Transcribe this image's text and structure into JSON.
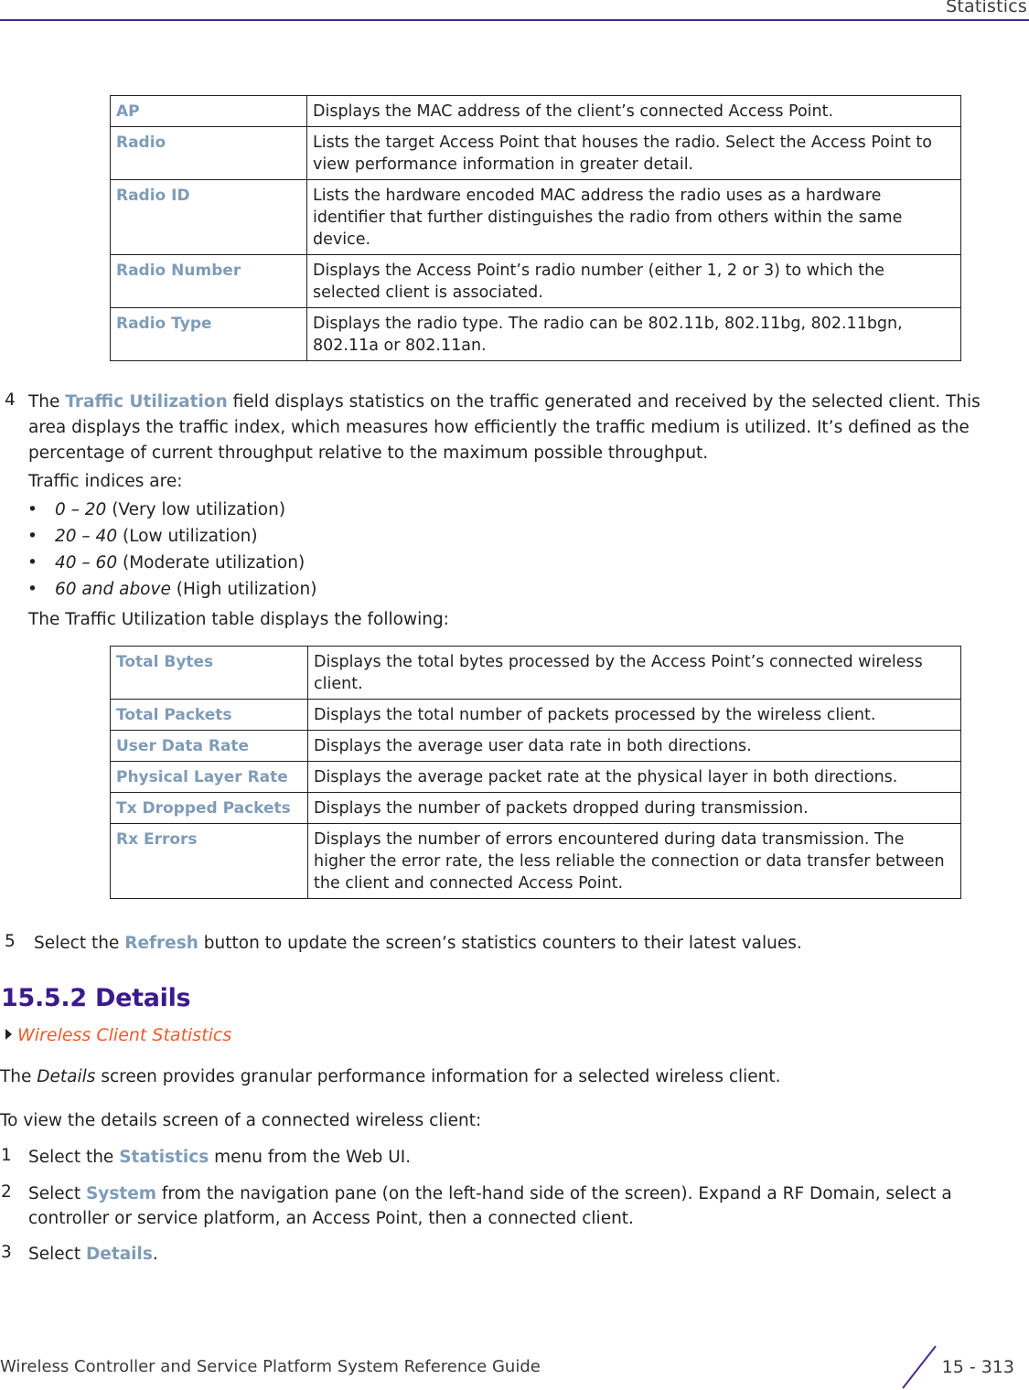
{
  "header": {
    "title": "Statistics"
  },
  "table1": {
    "rows": [
      {
        "term": "AP",
        "desc": "Displays the MAC address of the client’s connected Access Point."
      },
      {
        "term": "Radio",
        "desc": "Lists the target Access Point that houses the radio. Select the Access Point to view performance information in greater detail."
      },
      {
        "term": "Radio ID",
        "desc": "Lists the hardware encoded MAC address the radio uses as a hardware identifier that further distinguishes the radio from others within the same device."
      },
      {
        "term": "Radio Number",
        "desc": "Displays the Access Point’s radio number (either 1, 2 or 3) to which the selected client is associated."
      },
      {
        "term": "Radio Type",
        "desc": "Displays the radio type. The radio can be 802.11b, 802.11bg, 802.11bgn, 802.11a or 802.11an."
      }
    ]
  },
  "step4": {
    "number": "4",
    "prefix": "The ",
    "bold": "Traffic Utilization",
    "line1_rest": " field displays statistics on the traffic generated and received by the selected client. This",
    "line2": "area displays the traffic index, which measures how efficiently the traffic medium is utilized. It’s defined as the",
    "line3": "percentage of current throughput relative to the maximum possible throughput.",
    "indices_intro": "Traffic indices are:",
    "bullets": [
      {
        "range": "0 – 20",
        "label": " (Very low utilization)"
      },
      {
        "range": "20 – 40",
        "label": " (Low utilization)"
      },
      {
        "range": "40 – 60",
        "label": " (Moderate utilization)"
      },
      {
        "range": "60 and above",
        "label": " (High utilization)"
      }
    ],
    "table_intro": "The Traffic Utilization table displays the following:"
  },
  "table2": {
    "rows": [
      {
        "term": "Total Bytes",
        "desc": "Displays the total bytes processed by the Access Point’s connected wireless client."
      },
      {
        "term": "Total Packets",
        "desc": "Displays the total number of packets processed by the wireless client."
      },
      {
        "term": "User Data Rate",
        "desc": "Displays the average user data rate in both directions."
      },
      {
        "term": "Physical Layer Rate",
        "desc": "Displays the average packet rate at the physical layer in both directions."
      },
      {
        "term": "Tx Dropped Packets",
        "desc": "Displays the number of packets dropped during transmission."
      },
      {
        "term": "Rx Errors",
        "desc": "Displays the number of errors encountered during data transmission. The higher the error rate, the less reliable the connection or data transfer between the client and connected Access Point."
      }
    ]
  },
  "step5": {
    "number": "5",
    "prefix": "Select the ",
    "bold": "Refresh",
    "rest": " button to update the screen’s statistics counters to their latest values."
  },
  "section": {
    "heading": "15.5.2 Details",
    "xref": "Wireless Client Statistics",
    "intro_prefix": "The ",
    "intro_italic": "Details",
    "intro_rest": " screen provides granular performance information for a selected wireless client.",
    "howto": "To view the details screen of a connected wireless client:",
    "steps": [
      {
        "number": "1",
        "prefix": "Select the ",
        "bold": "Statistics",
        "rest": " menu from the Web UI."
      },
      {
        "number": "2",
        "prefix": "Select ",
        "bold": "System",
        "rest": " from the navigation pane (on the left-hand side of the screen). Expand a RF Domain, select a",
        "line2": "controller or service platform, an Access Point, then a connected client."
      },
      {
        "number": "3",
        "prefix": "Select ",
        "bold": "Details",
        "rest": "."
      }
    ]
  },
  "footer": {
    "guide_title": "Wireless Controller and Service Platform System Reference Guide",
    "page": "15 - 313"
  },
  "colors": {
    "accent_purple": "#3c1a8c",
    "term_blue": "#7f9cb7",
    "xref_orange": "#f05a28"
  }
}
